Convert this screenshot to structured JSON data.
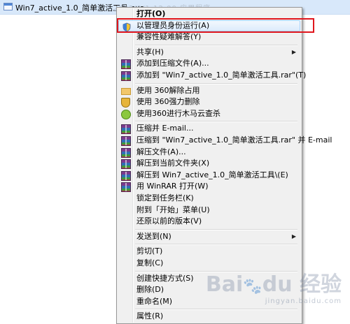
{
  "file": {
    "name": "Win7_active_1.0_简单激活工具.exe",
    "meta": "2022/1/1 12:00   应用程序"
  },
  "menu": {
    "items": [
      {
        "label": "打开(O)",
        "bold": true
      },
      {
        "label": "以管理员身份运行(A)",
        "icon": "uac-shield-icon",
        "highlighted": true
      },
      {
        "label": "兼容性疑难解答(Y)"
      },
      {
        "label": "共享(H)",
        "submenu": true
      },
      {
        "label": "添加到压缩文件(A)...",
        "icon": "winrar-icon"
      },
      {
        "label": "添加到 \"Win7_active_1.0_简单激活工具.rar\"(T)",
        "icon": "winrar-icon"
      },
      {
        "label": "使用 360解除占用",
        "icon": "360-unlock-icon"
      },
      {
        "label": "使用 360强力删除",
        "icon": "360-delete-icon"
      },
      {
        "label": "使用360进行木马云查杀",
        "icon": "360-scan-icon"
      },
      {
        "label": "压缩并 E-mail...",
        "icon": "winrar-icon"
      },
      {
        "label": "压缩到 \"Win7_active_1.0_简单激活工具.rar\" 并 E-mail",
        "icon": "winrar-icon"
      },
      {
        "label": "解压文件(A)...",
        "icon": "winrar-icon"
      },
      {
        "label": "解压到当前文件夹(X)",
        "icon": "winrar-icon"
      },
      {
        "label": "解压到 Win7_active_1.0_简单激活工具\\(E)",
        "icon": "winrar-icon"
      },
      {
        "label": "用 WinRAR 打开(W)",
        "icon": "winrar-icon"
      },
      {
        "label": "锁定到任务栏(K)"
      },
      {
        "label": "附到「开始」菜单(U)"
      },
      {
        "label": "还原以前的版本(V)"
      },
      {
        "label": "发送到(N)",
        "submenu": true
      },
      {
        "label": "剪切(T)"
      },
      {
        "label": "复制(C)"
      },
      {
        "label": "创建快捷方式(S)"
      },
      {
        "label": "删除(D)"
      },
      {
        "label": "重命名(M)"
      },
      {
        "label": "属性(R)"
      }
    ],
    "submenu_arrow": "▶"
  },
  "watermark": {
    "logo": "Bai",
    "logo_paw": "🐾",
    "logo_tail": "du 经验",
    "url": "jingyan.baidu.com"
  },
  "colors": {
    "highlight_border": "#a8d3fb",
    "annotation": "#e0161d",
    "menu_bg": "#f0f0f0"
  }
}
